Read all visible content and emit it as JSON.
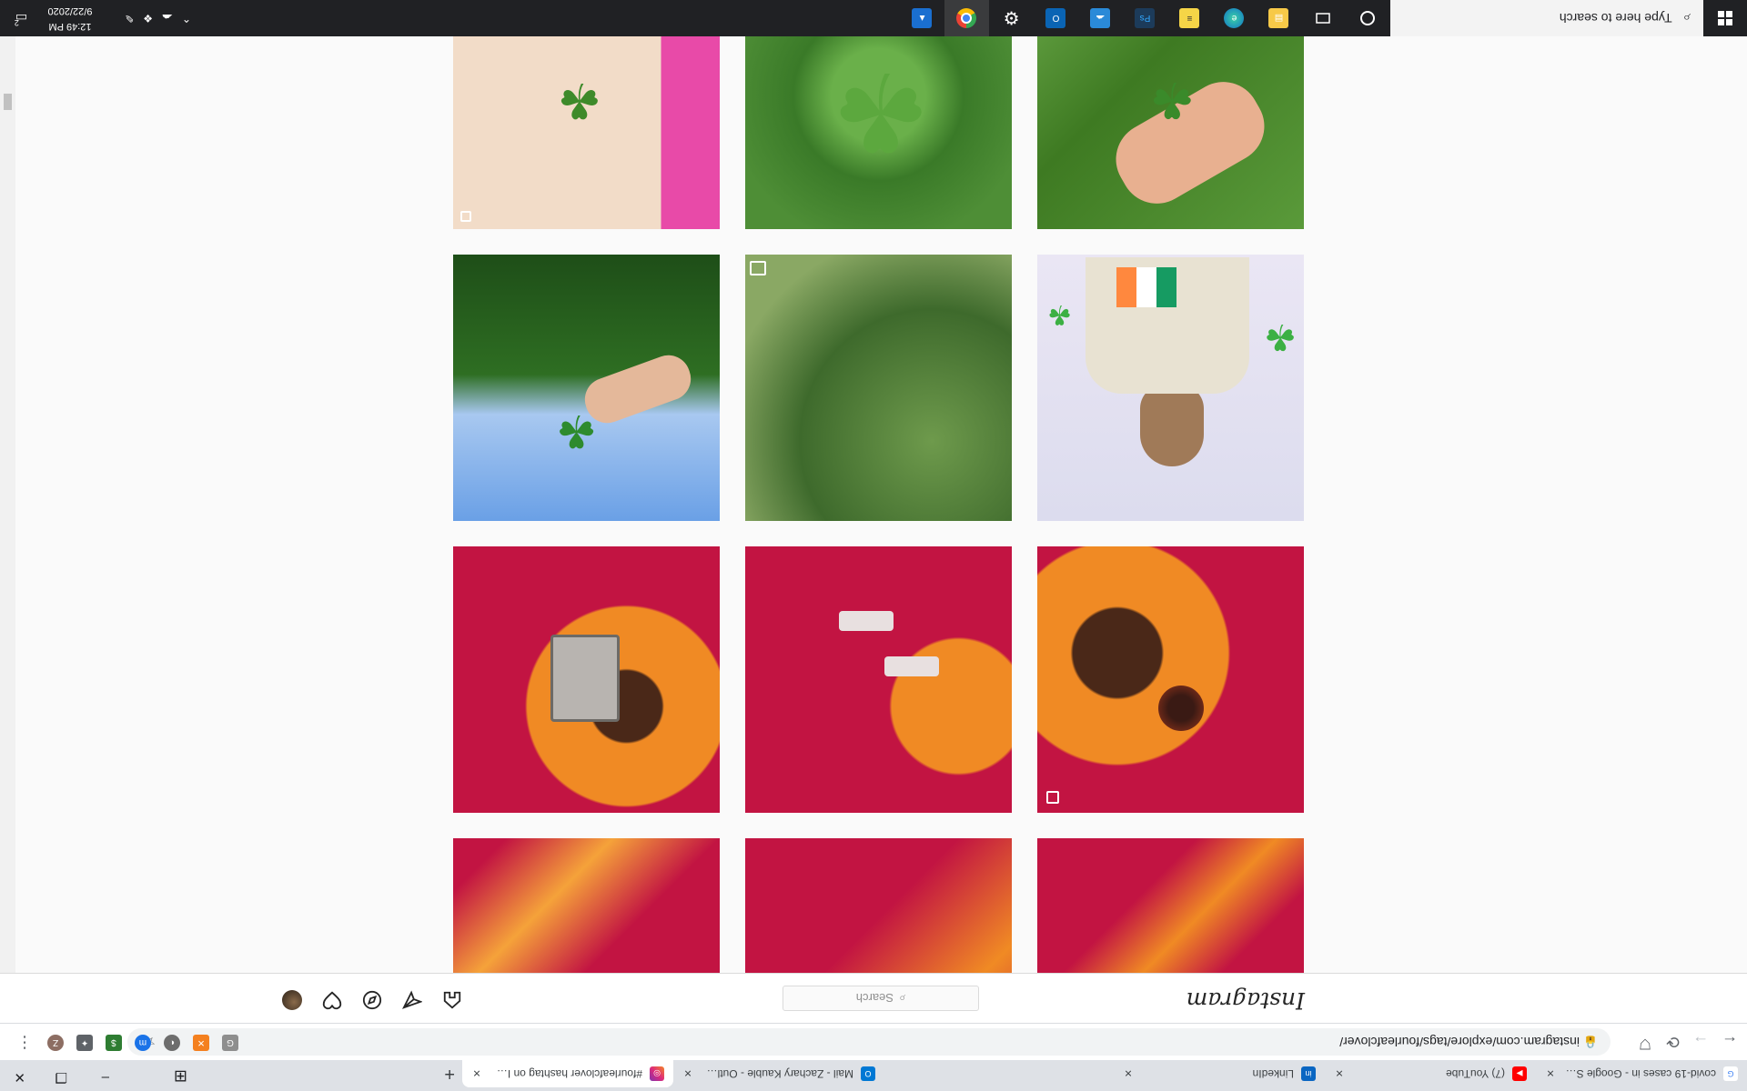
{
  "browser": {
    "tabs": [
      {
        "title": "covid-19 cases in - Google Searc",
        "favicon": "google-icon",
        "close": "×"
      },
      {
        "title": "(7) YouTube",
        "favicon": "youtube-icon",
        "close": "×"
      },
      {
        "title": "LinkedIn",
        "favicon": "linkedin-icon",
        "close": "×"
      },
      {
        "title": "Mail - Zachary Kauble - Outlook",
        "favicon": "outlook-icon",
        "close": "×"
      },
      {
        "title": "#fourleafclover hashtag on Insta",
        "favicon": "instagram-icon",
        "close": "×",
        "active": true
      }
    ],
    "new_tab": "+",
    "window_controls": {
      "minimize": "–",
      "restore": "❐",
      "close": "✕"
    },
    "back": "←",
    "forward": "→",
    "reload": "⟳",
    "url": "instagram.com/explore/tags/fourleafclover/",
    "extensions": [
      {
        "name": "shield-extension-icon",
        "glyph": "⛉",
        "color": "#5f6368"
      },
      {
        "name": "lock-icon",
        "glyph": "🔒"
      },
      {
        "name": "ext-g",
        "glyph": "G",
        "color": "#8e8e8e"
      },
      {
        "name": "ext-orange",
        "glyph": "✕",
        "color": "#f4801f"
      },
      {
        "name": "ext-circle",
        "glyph": "◐",
        "color": "#8e8e8e"
      },
      {
        "name": "ext-blue",
        "glyph": "m",
        "color": "#1a73e8"
      },
      {
        "name": "ext-dollar",
        "glyph": "$",
        "color": "#2e7d32"
      },
      {
        "name": "puzzle-icon",
        "glyph": "✦",
        "color": "#5f6368"
      },
      {
        "name": "profile-avatar",
        "glyph": "Z",
        "color": "#8d6e63"
      },
      {
        "name": "menu-icon",
        "glyph": "⋮",
        "color": "#5f6368"
      }
    ]
  },
  "instagram": {
    "logo": "Instagram",
    "search_placeholder": "Search",
    "nav_icons": [
      "home-icon",
      "direct-icon",
      "explore-icon",
      "activity-icon",
      "profile-avatar"
    ]
  },
  "taskbar": {
    "search_placeholder": "Type here to search",
    "date": "9/22/2020",
    "time": "12:49 PM",
    "apps": [
      "cortana-icon",
      "task-view-icon",
      "file-explorer-icon",
      "edge-icon",
      "sticky-notes-icon",
      "photoshop-icon",
      "weather-icon",
      "outlook-icon",
      "settings-icon",
      "chrome-icon",
      "photos-icon"
    ],
    "notification_count": "2"
  }
}
